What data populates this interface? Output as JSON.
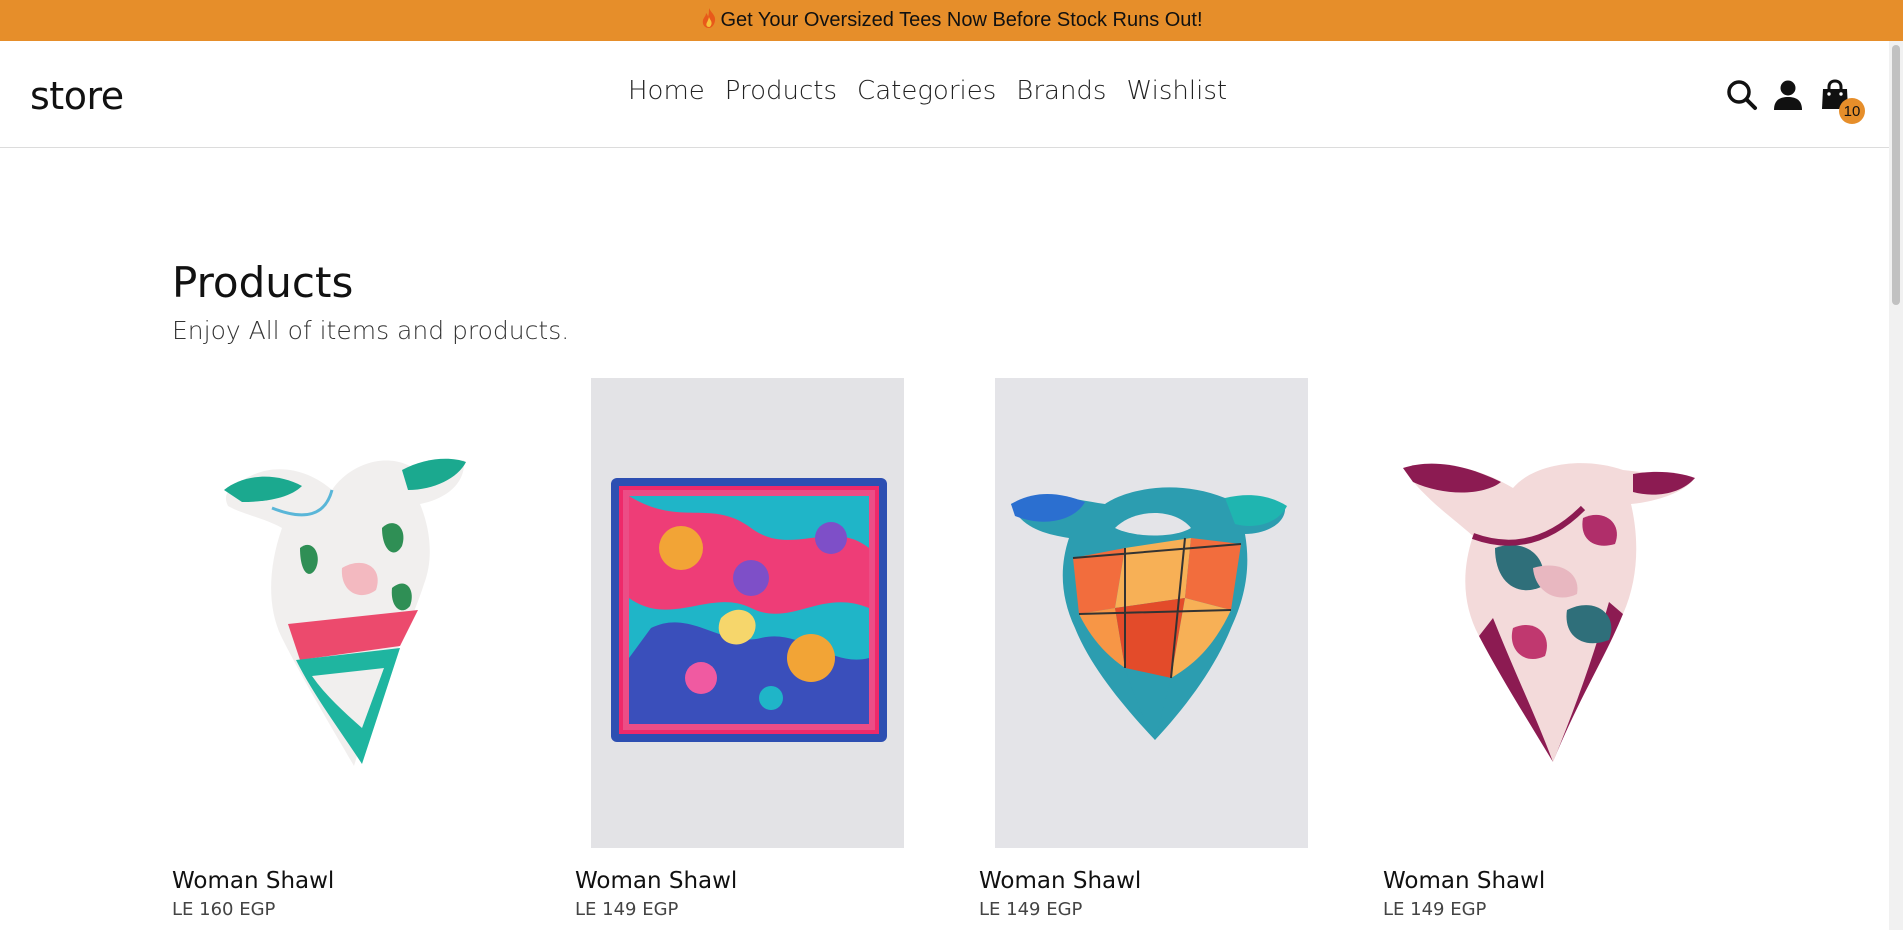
{
  "announcement": {
    "icon": "flame-icon",
    "text": "Get Your Oversized Tees Now Before Stock Runs Out!",
    "bg": "#e68e2a"
  },
  "header": {
    "logo": "store",
    "nav": [
      "Home",
      "Products",
      "Categories",
      "Brands",
      "Wishlist"
    ],
    "icons": [
      "search-icon",
      "user-icon",
      "cart-icon"
    ],
    "cart_count": "10"
  },
  "page": {
    "title": "Products",
    "subtitle": "Enjoy All of items and products."
  },
  "products": [
    {
      "name": "Woman Shawl",
      "price": "LE 160 EGP",
      "image": "floral-scarf-image"
    },
    {
      "name": "Woman Shawl",
      "price": "LE 149 EGP",
      "image": "square-print-scarf-image"
    },
    {
      "name": "Woman Shawl",
      "price": "LE 149 EGP",
      "image": "geometric-scarf-image"
    },
    {
      "name": "Woman Shawl",
      "price": "LE 149 EGP",
      "image": "burgundy-leaf-scarf-image"
    }
  ]
}
